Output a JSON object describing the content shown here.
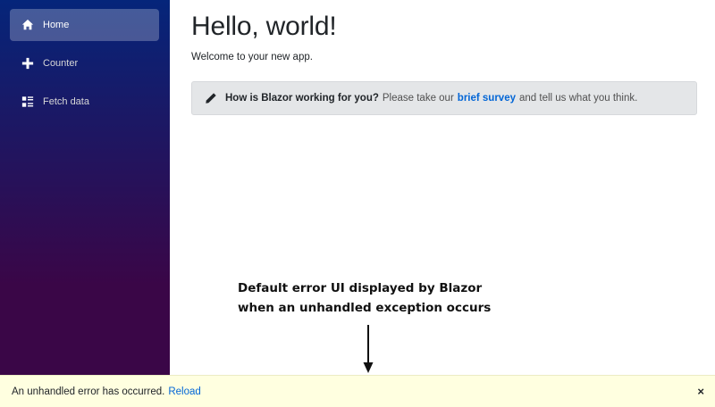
{
  "sidebar": {
    "items": [
      {
        "label": "Home",
        "icon": "home-icon",
        "active": true
      },
      {
        "label": "Counter",
        "icon": "plus-icon",
        "active": false
      },
      {
        "label": "Fetch data",
        "icon": "list-rich-icon",
        "active": false
      }
    ]
  },
  "main": {
    "title": "Hello, world!",
    "subtitle": "Welcome to your new app.",
    "survey": {
      "icon": "pencil-icon",
      "question": "How is Blazor working for you?",
      "prefix": "Please take our",
      "link": "brief survey",
      "suffix": "and tell us what you think."
    }
  },
  "annotation": {
    "line1": "Default error UI displayed by Blazor",
    "line2": "when an unhandled exception occurs"
  },
  "error_bar": {
    "message": "An unhandled error has occurred.",
    "reload": "Reload",
    "dismiss": "×"
  },
  "colors": {
    "sidebar_top": "#05257a",
    "sidebar_bottom": "#3a0647",
    "link": "#0366d6",
    "error_bg": "#ffffe0"
  }
}
